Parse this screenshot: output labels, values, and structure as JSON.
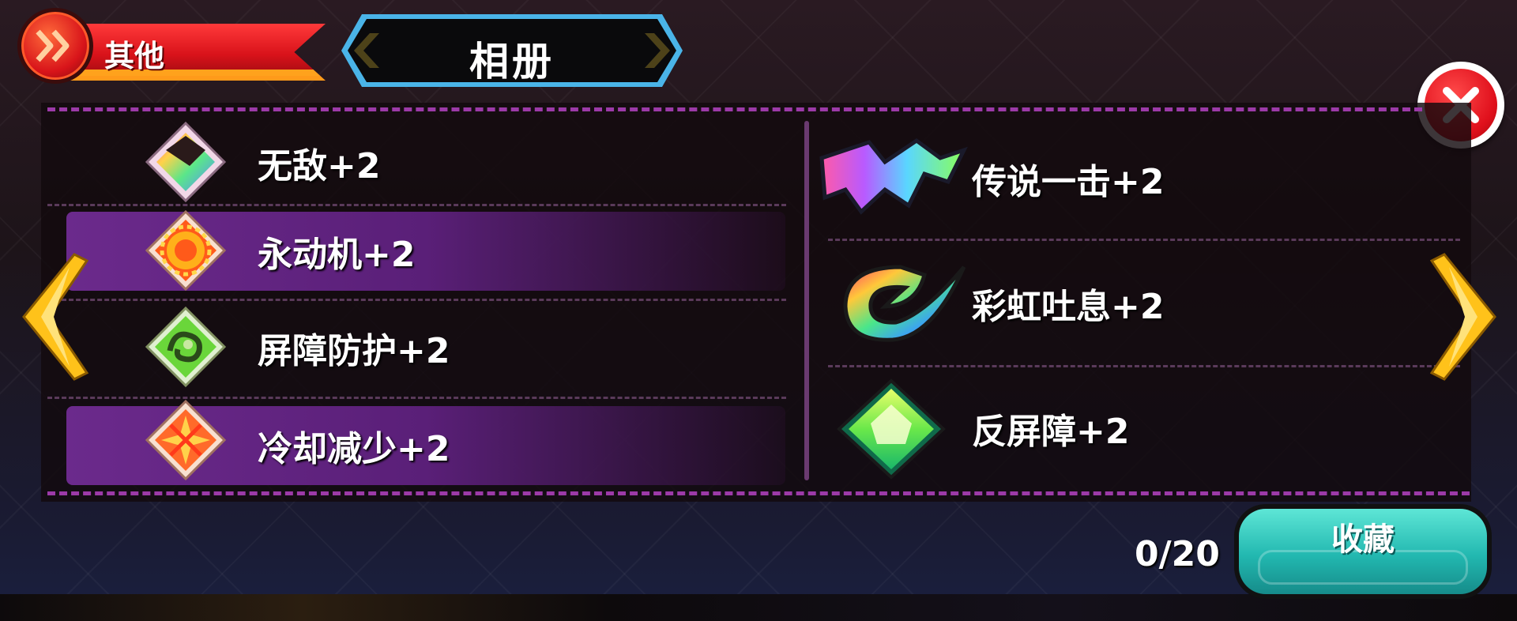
{
  "header": {
    "category_label": "其他",
    "title": "相册"
  },
  "left_column": [
    {
      "label": "无敌+2",
      "icon": "rainbow-shield-icon",
      "highlighted": false
    },
    {
      "label": "永动机+2",
      "icon": "sun-gear-icon",
      "highlighted": true
    },
    {
      "label": "屏障防护+2",
      "icon": "barrier-dragon-icon",
      "highlighted": false
    },
    {
      "label": "冷却减少+2",
      "icon": "cooldown-burst-icon",
      "highlighted": true
    }
  ],
  "right_column": [
    {
      "label": "传说一击+2",
      "icon": "legend-strike-icon"
    },
    {
      "label": "彩虹吐息+2",
      "icon": "rainbow-breath-icon"
    },
    {
      "label": "反屏障+2",
      "icon": "anti-barrier-gem-icon"
    }
  ],
  "footer": {
    "count": "0/20",
    "collect_label": "收藏"
  },
  "colors": {
    "accent_purple": "#9c3aa8",
    "highlight_row": "#6b2a8c",
    "collect_button": "#22b8b0",
    "ribbon_red": "#d8121a",
    "arrow_yellow": "#ffc21a"
  }
}
